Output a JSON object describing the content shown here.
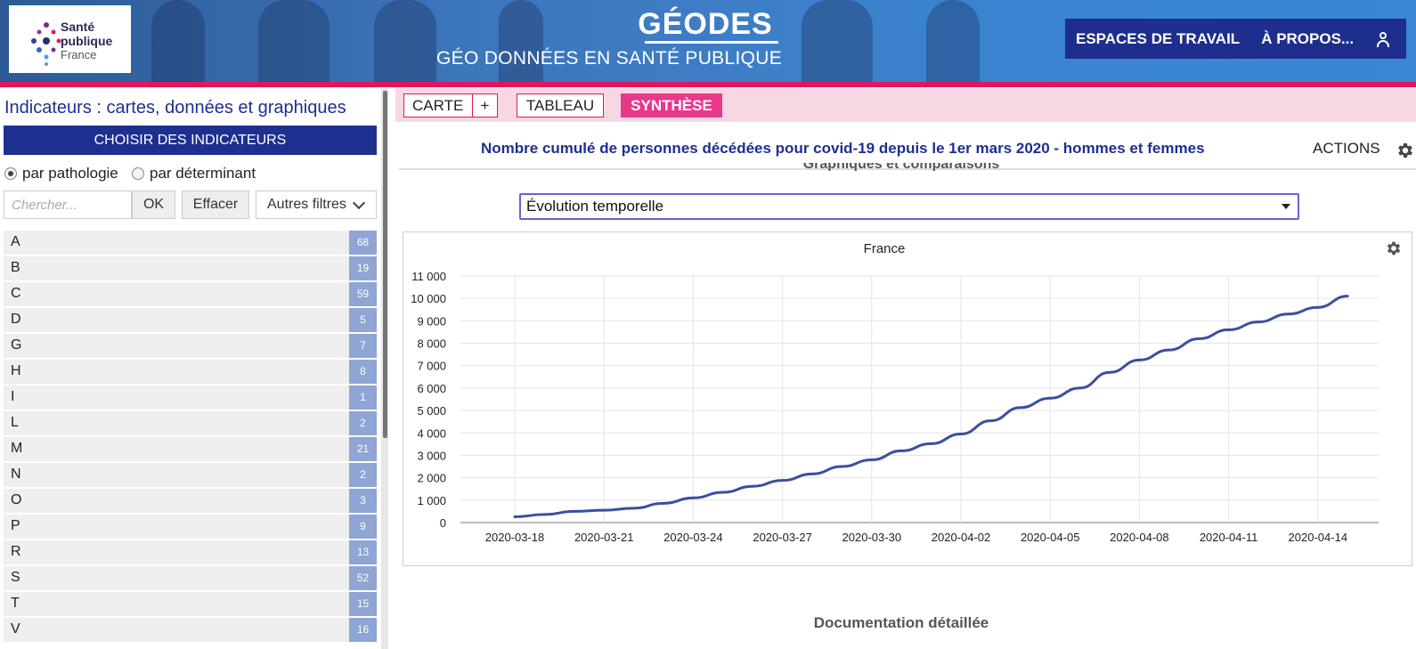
{
  "header": {
    "logo": {
      "line1": "Santé",
      "line2": "publique",
      "line3": "France"
    },
    "title": "GÉODES",
    "subtitle": "GÉO DONNÉES EN SANTÉ PUBLIQUE",
    "nav": {
      "workspaces": "ESPACES DE TRAVAIL",
      "about": "À PROPOS..."
    },
    "brand_color": "#1f2f8f",
    "accent_color": "#e2165e"
  },
  "sidebar": {
    "title": "Indicateurs : cartes, données et graphiques",
    "choose_button": "CHOISIR DES INDICATEURS",
    "radio_pathology": "par pathologie",
    "radio_determinant": "par déterminant",
    "radio_selected": "pathology",
    "search_placeholder": "Chercher...",
    "ok_button": "OK",
    "clear_button": "Effacer",
    "filters_button": "Autres filtres",
    "letters": [
      {
        "letter": "A",
        "count": "68"
      },
      {
        "letter": "B",
        "count": "19"
      },
      {
        "letter": "C",
        "count": "59"
      },
      {
        "letter": "D",
        "count": "5"
      },
      {
        "letter": "G",
        "count": "7"
      },
      {
        "letter": "H",
        "count": "8"
      },
      {
        "letter": "I",
        "count": "1"
      },
      {
        "letter": "L",
        "count": "2"
      },
      {
        "letter": "M",
        "count": "21"
      },
      {
        "letter": "N",
        "count": "2"
      },
      {
        "letter": "O",
        "count": "3"
      },
      {
        "letter": "P",
        "count": "9"
      },
      {
        "letter": "R",
        "count": "13"
      },
      {
        "letter": "S",
        "count": "52"
      },
      {
        "letter": "T",
        "count": "15"
      },
      {
        "letter": "V",
        "count": "16"
      }
    ]
  },
  "tabs": {
    "map": "CARTE",
    "add": "+",
    "table": "TABLEAU",
    "summary": "SYNTHÈSE",
    "active": "summary"
  },
  "main": {
    "indicator_title": "Nombre cumulé de personnes décédées pour covid-19 depuis le 1er mars 2020 - hommes et femmes",
    "actions_label": "ACTIONS",
    "section_title": "Graphiques et comparaisons",
    "view_select": "Évolution temporelle",
    "doc_title": "Documentation détaillée"
  },
  "chart_data": {
    "type": "line",
    "title": "France",
    "xlabel": "",
    "ylabel": "",
    "ylim": [
      0,
      11000
    ],
    "y_ticks": [
      "0",
      "1 000",
      "2 000",
      "3 000",
      "4 000",
      "5 000",
      "6 000",
      "7 000",
      "8 000",
      "9 000",
      "10 000",
      "11 000"
    ],
    "x_ticks": [
      "2020-03-18",
      "2020-03-21",
      "2020-03-24",
      "2020-03-27",
      "2020-03-30",
      "2020-04-02",
      "2020-04-05",
      "2020-04-08",
      "2020-04-11",
      "2020-04-14"
    ],
    "grid": true,
    "series": [
      {
        "color": "#3a4fa0",
        "x": [
          "2020-03-18",
          "2020-03-19",
          "2020-03-20",
          "2020-03-21",
          "2020-03-22",
          "2020-03-23",
          "2020-03-24",
          "2020-03-25",
          "2020-03-26",
          "2020-03-27",
          "2020-03-28",
          "2020-03-29",
          "2020-03-30",
          "2020-03-31",
          "2020-04-01",
          "2020-04-02",
          "2020-04-03",
          "2020-04-04",
          "2020-04-05",
          "2020-04-06",
          "2020-04-07",
          "2020-04-08",
          "2020-04-09",
          "2020-04-10",
          "2020-04-11",
          "2020-04-12",
          "2020-04-13",
          "2020-04-14",
          "2020-04-15"
        ],
        "values": [
          260,
          360,
          500,
          550,
          640,
          860,
          1100,
          1350,
          1620,
          1880,
          2170,
          2500,
          2800,
          3200,
          3520,
          3950,
          4540,
          5130,
          5550,
          6000,
          6700,
          7250,
          7700,
          8200,
          8600,
          8950,
          9300,
          9600,
          10100
        ]
      }
    ]
  }
}
